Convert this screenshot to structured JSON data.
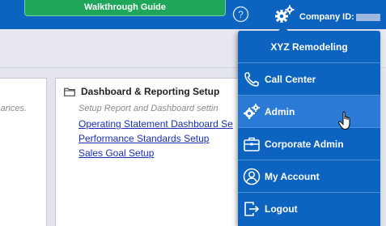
{
  "topbar": {
    "guide_label": "Walkthrough Guide",
    "company_label": "Company ID:",
    "icons": [
      "help-icon",
      "gear-icon"
    ]
  },
  "cards": {
    "left_tail": "ances.",
    "title": "Dashboard & Reporting Setup",
    "description": "Setup Report and Dashboard settin",
    "links": [
      "Operating Statement Dashboard Se",
      "Performance Standards Setup",
      "Sales Goal Setup"
    ]
  },
  "menu": {
    "header": "XYZ Remodeling",
    "items": [
      {
        "label": "Call Center",
        "icon": "phone-icon"
      },
      {
        "label": "Admin",
        "icon": "gears-icon"
      },
      {
        "label": "Corporate Admin",
        "icon": "briefcase-icon"
      },
      {
        "label": "My Account",
        "icon": "user-icon"
      },
      {
        "label": "Logout",
        "icon": "logout-icon"
      }
    ]
  },
  "colors": {
    "brand_blue": "#0d63c0",
    "guide_green": "#1fa65a",
    "link_blue": "#1a2fb8",
    "hover_blue": "#2b7ad6"
  }
}
